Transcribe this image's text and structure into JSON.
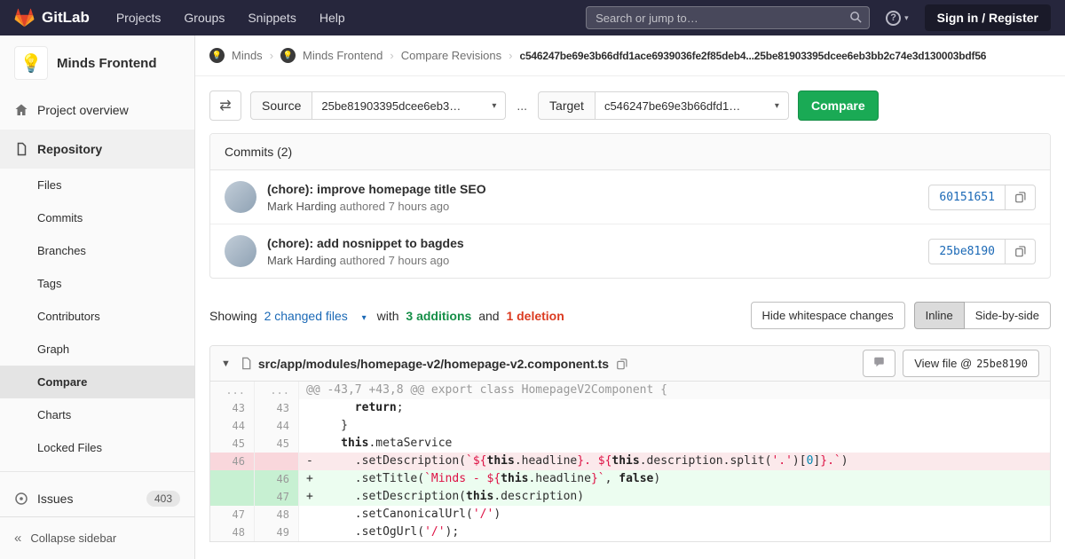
{
  "colors": {
    "brand_orange": "#e24329",
    "navbar_bg": "#26263c",
    "button_green": "#1aaa55",
    "additions_green": "#168f48",
    "deletions_red": "#db3b21",
    "link_blue": "#1b69b6"
  },
  "navbar": {
    "logo_text": "GitLab",
    "menu": [
      "Projects",
      "Groups",
      "Snippets",
      "Help"
    ],
    "search_placeholder": "Search or jump to…",
    "help_glyph": "?",
    "sign_in_label": "Sign in / Register"
  },
  "sidebar": {
    "project_name": "Minds Frontend",
    "project_avatar": "💡",
    "overview_label": "Project overview",
    "repository_label": "Repository",
    "repo_sub": [
      "Files",
      "Commits",
      "Branches",
      "Tags",
      "Contributors",
      "Graph",
      "Compare",
      "Charts",
      "Locked Files"
    ],
    "issues_label": "Issues",
    "issues_count": "403",
    "collapse_label": "Collapse sidebar",
    "collapse_glyph": "«"
  },
  "breadcrumb": {
    "group": "Minds",
    "group_avatar": "💡",
    "project": "Minds Frontend",
    "project_avatar": "💡",
    "sep": "›",
    "page": "Compare Revisions",
    "compare_range": "c546247be69e3b66dfd1ace6939036fe2f85deb4...25be81903395dcee6eb3bb2c74e3d130003bdf56"
  },
  "compare_form": {
    "swap_glyph": "⇄",
    "source_label": "Source",
    "source_value": "25be81903395dcee6eb3…",
    "separator": "...",
    "target_label": "Target",
    "target_value": "c546247be69e3b66dfd1…",
    "caret": "▾",
    "compare_button": "Compare"
  },
  "commits": {
    "title": "Commits (2)",
    "items": [
      {
        "title": "(chore): improve homepage title SEO",
        "author": "Mark Harding",
        "meta": "authored 7 hours ago",
        "sha": "60151651"
      },
      {
        "title": "(chore): add nosnippet to bagdes",
        "author": "Mark Harding",
        "meta": "authored 7 hours ago",
        "sha": "25be8190"
      }
    ]
  },
  "diff_summary": {
    "showing": "Showing",
    "files_link": "2 changed files",
    "caret": "▾",
    "with_text": "with",
    "additions": "3 additions",
    "and_text": "and",
    "deletions": "1 deletion",
    "whitespace_button": "Hide whitespace changes",
    "inline_label": "Inline",
    "side_by_side_label": "Side-by-side"
  },
  "diff_file": {
    "collapse_caret": "▼",
    "path": "src/app/modules/homepage-v2/homepage-v2.component.ts",
    "view_file_label": "View file @",
    "view_file_sha": "25be8190",
    "lines": [
      {
        "type": "hunk",
        "old": "...",
        "new": "...",
        "tokens": [
          [
            "h",
            "@@ -43,7 +43,8 @@ export class HomepageV2Component {"
          ]
        ]
      },
      {
        "type": "ctx",
        "old": "43",
        "new": "43",
        "tokens": [
          [
            "t",
            "       "
          ],
          [
            "k",
            "return"
          ],
          [
            "t",
            ";"
          ]
        ]
      },
      {
        "type": "ctx",
        "old": "44",
        "new": "44",
        "tokens": [
          [
            "t",
            "     }"
          ]
        ]
      },
      {
        "type": "ctx",
        "old": "45",
        "new": "45",
        "tokens": [
          [
            "t",
            "     "
          ],
          [
            "k",
            "this"
          ],
          [
            "t",
            ".metaService"
          ]
        ]
      },
      {
        "type": "del",
        "old": "46",
        "new": "",
        "tokens": [
          [
            "t",
            "-      .setDescription("
          ],
          [
            "s",
            "`"
          ],
          [
            "si",
            "${"
          ],
          [
            "k",
            "this"
          ],
          [
            "t",
            ".headline"
          ],
          [
            "si",
            "}"
          ],
          [
            "s",
            ". "
          ],
          [
            "si",
            "${"
          ],
          [
            "k",
            "this"
          ],
          [
            "t",
            ".description.split("
          ],
          [
            "s",
            "'.'"
          ],
          [
            "t",
            ")["
          ],
          [
            "n",
            "0"
          ],
          [
            "t",
            "]"
          ],
          [
            "si",
            "}"
          ],
          [
            "s",
            ".`"
          ],
          [
            "t",
            ")"
          ]
        ]
      },
      {
        "type": "add",
        "old": "",
        "new": "46",
        "tokens": [
          [
            "t",
            "+      .setTitle("
          ],
          [
            "s",
            "`Minds - "
          ],
          [
            "si",
            "${"
          ],
          [
            "k",
            "this"
          ],
          [
            "t",
            ".headline"
          ],
          [
            "si",
            "}"
          ],
          [
            "s",
            "`"
          ],
          [
            "t",
            ", "
          ],
          [
            "k",
            "false"
          ],
          [
            "t",
            ")"
          ]
        ]
      },
      {
        "type": "add",
        "old": "",
        "new": "47",
        "tokens": [
          [
            "t",
            "+      .setDescription("
          ],
          [
            "k",
            "this"
          ],
          [
            "t",
            ".description)"
          ]
        ]
      },
      {
        "type": "ctx",
        "old": "47",
        "new": "48",
        "tokens": [
          [
            "t",
            "       .setCanonicalUrl("
          ],
          [
            "s",
            "'/'"
          ],
          [
            "t",
            ")"
          ]
        ]
      },
      {
        "type": "ctx",
        "old": "48",
        "new": "49",
        "tokens": [
          [
            "t",
            "       .setOgUrl("
          ],
          [
            "s",
            "'/'"
          ],
          [
            "t",
            ");"
          ]
        ]
      }
    ]
  }
}
